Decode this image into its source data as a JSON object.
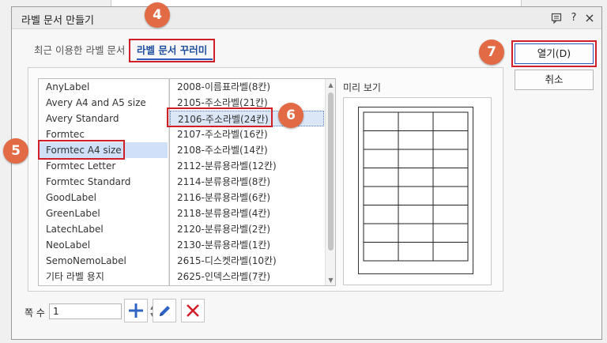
{
  "dialog": {
    "title": "라벨 문서 만들기",
    "help_glyph": "?",
    "close_glyph": "×"
  },
  "tabs": [
    {
      "label": "최근 이용한 라벨 문서",
      "active": false
    },
    {
      "label": "라벨 문서 꾸러미",
      "active": true
    }
  ],
  "vendors": {
    "items": [
      "AnyLabel",
      "Avery A4 and A5 size",
      "Avery Standard",
      "Formtec",
      "Formtec A4 size",
      "Formtec Letter",
      "Formtec Standard",
      "GoodLabel",
      "GreenLabel",
      "LatechLabel",
      "NeoLabel",
      "SemoNemoLabel",
      "기타 라벨 용지"
    ],
    "selected_index": 4
  },
  "label_types": {
    "items": [
      "2008-이름표라벨(8칸)",
      "2105-주소라벨(21칸)",
      "2106-주소라벨(24칸)",
      "2107-주소라벨(16칸)",
      "2108-주소라벨(14칸)",
      "2112-분류용라벨(12칸)",
      "2114-분류용라벨(8칸)",
      "2116-분류용라벨(6칸)",
      "2118-분류용라벨(4칸)",
      "2120-분류용라벨(2칸)",
      "2130-분류용라벨(1칸)",
      "2615-디스켓라벨(10칸)",
      "2625-인덱스라벨(7칸)"
    ],
    "selected_index": 2
  },
  "preview": {
    "label": "미리 보기",
    "grid": {
      "columns": 3,
      "rows": 8
    }
  },
  "buttons": {
    "open_label": "열기(D)",
    "cancel_label": "취소"
  },
  "pages": {
    "label": "쪽 수",
    "value": "1"
  },
  "colors": {
    "accent": "#2a5bb8",
    "highlight": "#d11f2a",
    "badge": "#e26a45",
    "add": "#2f63c4",
    "edit": "#2f63c4",
    "delete": "#d11f2a"
  },
  "annotations": [
    "4",
    "5",
    "6",
    "7"
  ]
}
